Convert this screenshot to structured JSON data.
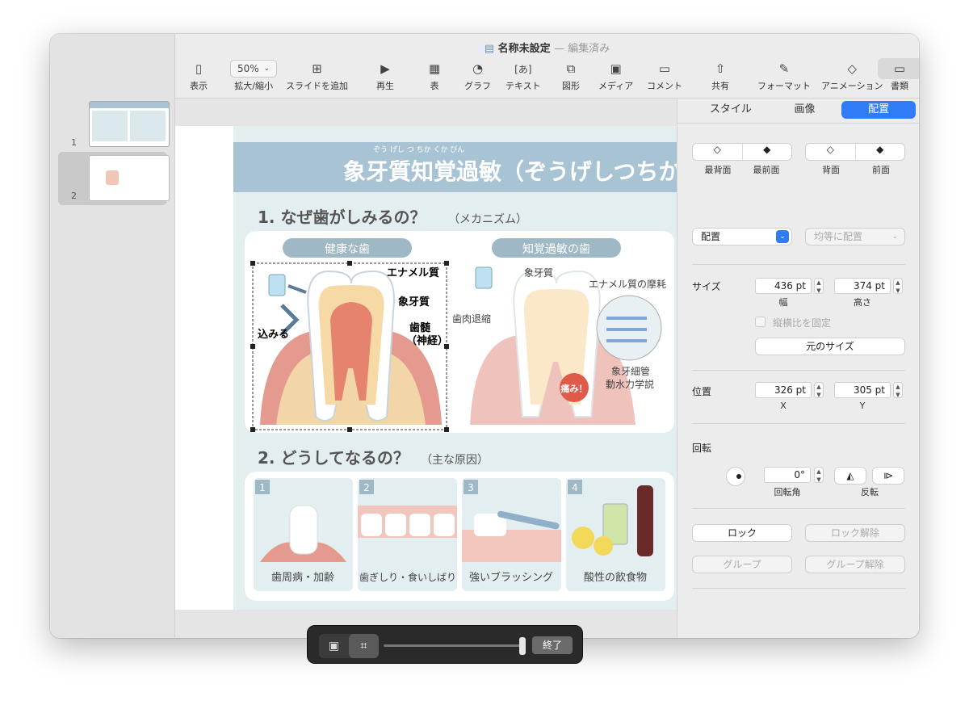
{
  "window": {
    "title": "名称未設定",
    "title_status": "編集済み"
  },
  "toolbar": {
    "view": "表示",
    "zoom_value": "50%",
    "zoom": "拡大/縮小",
    "add_slide": "スライドを追加",
    "play": "再生",
    "table": "表",
    "chart": "グラフ",
    "text": "テキスト",
    "shape": "図形",
    "media": "メディア",
    "comment": "コメント",
    "share": "共有",
    "format": "フォーマット",
    "animate": "アニメーション",
    "document": "書類"
  },
  "slides": {
    "items": [
      {
        "num": "1"
      },
      {
        "num": "2"
      }
    ]
  },
  "slide": {
    "ruby": "ぞう げし つ ちか くか びん",
    "title": "象牙質知覚過敏（ぞうげしつちか",
    "section1": "1. なぜ歯がしみるの？",
    "section1_sub": "（メカニズム）",
    "healthy": "健康な歯",
    "sensitive": "知覚過敏の歯",
    "enamel": "エナメル質",
    "dentin": "象牙質",
    "pulp1": "歯髄",
    "pulp2": "（神経）",
    "pushes": "込みる",
    "dentin2": "象牙質",
    "enamel_wear": "エナメル質の摩耗",
    "gum": "歯肉退縮",
    "pain": "痛み！",
    "tubule1": "象牙細管",
    "tubule2": "動水力学説",
    "section2": "2. どうしてなるの？",
    "section2_sub": "（主な原因）",
    "causes": [
      {
        "num": "1",
        "label": "歯周病・加齢"
      },
      {
        "num": "2",
        "label": "歯ぎしり・食いしばり"
      },
      {
        "num": "3",
        "label": "強いブラッシング"
      },
      {
        "num": "4",
        "label": "酸性の飲食物"
      }
    ]
  },
  "inspector": {
    "tabs": [
      "スタイル",
      "画像",
      "配置"
    ],
    "back": "最背面",
    "front": "最前面",
    "backward": "背面",
    "forward": "前面",
    "align": "配置",
    "distribute": "均等に配置",
    "size_label": "サイズ",
    "width": "436 pt",
    "width_label": "幅",
    "height": "374 pt",
    "height_label": "高さ",
    "constrain": "縦横比を固定",
    "original": "元のサイズ",
    "pos_label": "位置",
    "x": "326 pt",
    "x_label": "X",
    "y": "305 pt",
    "y_label": "Y",
    "rot_label": "回転",
    "angle": "0°",
    "angle_label": "回転角",
    "flip_label": "反転",
    "lock": "ロック",
    "unlock": "ロック解除",
    "group": "グループ",
    "ungroup": "グループ解除"
  },
  "crop_popup": {
    "done": "終了"
  },
  "colors": {
    "accent": "#2f7cf6",
    "banner": "#a8c4d4",
    "section_bg": "#e3eef0"
  }
}
